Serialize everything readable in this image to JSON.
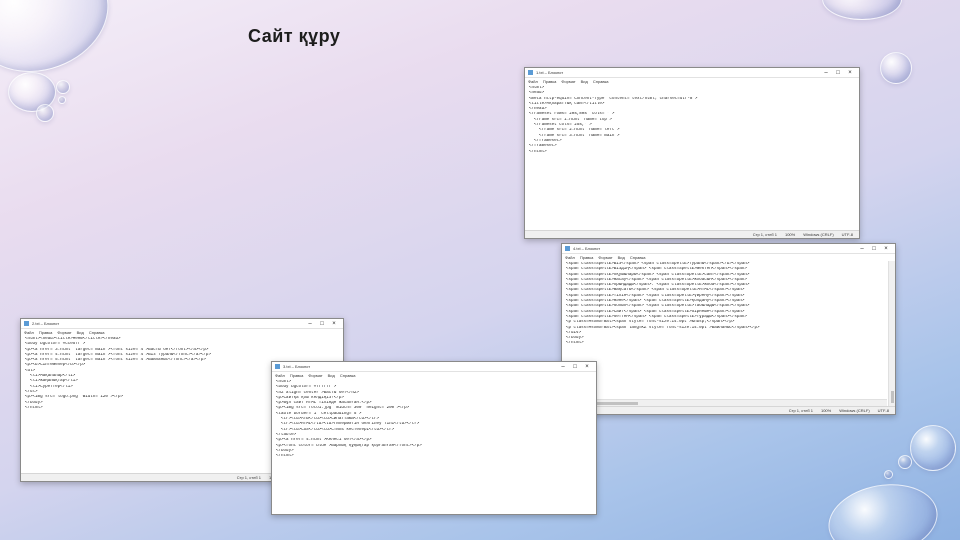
{
  "slide": {
    "title": "Сайт құру"
  },
  "windows": {
    "w1": {
      "title": "1.txt – Блокнот",
      "menu": [
        "Файл",
        "Правка",
        "Формат",
        "Вид",
        "Справка"
      ],
      "status": [
        "Стр 1, стлб 1",
        "100%",
        "Windows (CRLF)",
        "UTF-8"
      ],
      "lines": [
        "<html>",
        "<head>",
        "<meta http-equiv=\"Content-Type\" content=\"text/html; charset=utf-8\">",
        "<title>Ақпараттық сайт</title>",
        "</head>",
        "",
        "<frameset rows=\"20%,80%\" cols=\"*\">",
        "  <frame src=\"1.html\" name=\"top\">",
        "",
        "  <frameset cols=\"25%,*\">",
        "    <frame src=\"2.html\" name=\"left\">",
        "    <frame src=\"3.html\" name=\"main\">",
        "  </frameset>",
        "</frameset>",
        "",
        "</html>"
      ]
    },
    "w2": {
      "title": "2.txt – Блокнот",
      "menu": [
        "Файл",
        "Правка",
        "Формат",
        "Вид",
        "Справка"
      ],
      "status": [
        "Стр 1, стлб 1",
        "100%",
        "Windows (CRLF)",
        "UTF-8"
      ],
      "lines": [
        "<html><head><title>Меню</title></head>",
        "<body bgcolor=\"#cce5ff\">",
        "<p><a href=\"3.html\" target=\"main\"><font size=\"4\">Басты бет</font></a></p>",
        "<p><a href=\"4.html\" target=\"main\"><font size=\"4\">Біз туралы</font></a></p>",
        "<p><a href=\"5.html\" target=\"main\"><font size=\"4\">Байланыс</font></a></p>",
        "",
        "<p><b>Сілтемелер</b></p>",
        "<ul>",
        "  <li>Мақалалар</li>",
        "  <li>Жаңалықтар</li>",
        "  <li>Суреттер</li>",
        "</ul>",
        "<p><img src=\"logo.png\" width=\"120\"></p>",
        "",
        "</body>",
        "</html>"
      ]
    },
    "w3": {
      "title": "3.txt – Блокнот",
      "menu": [
        "Файл",
        "Правка",
        "Формат",
        "Вид",
        "Справка"
      ],
      "status": [
        "Стр 1, стлб 1",
        "100%",
        "Windows (CRLF)",
        "UTF-8"
      ],
      "lines": [
        "<html>",
        "<body bgcolor=\"#ffffff\">",
        "<h2 align=\"center\">Басты бет</h2>",
        "<p>Сайтқа қош келдіңіз!</p>",
        "<p>Бұл сайт HTML тілінде жасалған.</p>",
        "",
        "<p><img src=\"foto1.jpg\" width=\"300\" height=\"200\"></p>",
        "",
        "<table border=\"1\" cellpadding=\"5\">",
        "  <tr><td>Аты</td><td>Сипаттама</td></tr>",
        "  <tr><td>HTML</td><td>Гипермәтін белгілеу тілі</td></tr>",
        "  <tr><td>CSS</td><td>Стиль кестелері</td></tr>",
        "</table>",
        "",
        "<p><a href=\"4.html\">Келесі бет</a></p>",
        "",
        "<p><font color=\"blue\">Барлық құқықтар қорғалған</font></p>",
        "</body>",
        "</html>"
      ]
    },
    "w4": {
      "title": "4.txt – Блокнот",
      "menu": [
        "Файл",
        "Правка",
        "Формат",
        "Вид",
        "Справка"
      ],
      "status": [
        "Стр 1, стлб 1",
        "100%",
        "Windows (CRLF)",
        "UTF-8"
      ],
      "lines": [
        "<span class=SpellE>Біз</span> <span class=SpellE>туралы</span></b></span>",
        "<span class=SpellE>Біздің</span> <span class=SpellE>мектеп</span></span>",
        "<span class=SpellE>оқушылары</span> <span class=SpellE>сайт</span></span>",
        "<span class=SpellE>жасау</span> <span class=SpellE>жобасын</span></span>",
        "<span class=SpellE>орындады</span>. <span class=SpellE>Жоба</span></span>",
        "<span class=SpellE>мақсаты</span> <span class=SpellE>HTML</span></span>",
        "<span class=SpellE>тілін</span> <span class=SpellE>үйрену</span></span>",
        "<span class=SpellE>және</span> <span class=SpellE>қолдану</span></span>",
        "<span class=SpellE>болып</span> <span class=SpellE>табылады</span></span>",
        "<span class=SpellE>Сайт</span> <span class=SpellE>бірнеше</span></span>",
        "<span class=SpellE>беттен</span> <span class=SpellE>тұрады</span></span>",
        "<p class=MsoNormal><span style='font-size:14.0pt'>&nbsp;</span></p>",
        "",
        "<p class=MsoNormal><span lang=KZ style='font-size:14.0pt'>Байланыс</span></p>",
        "",
        "</div>",
        "",
        "</body>",
        "",
        "</html>"
      ]
    },
    "w5": {
      "title": "5.txt – Блокнот",
      "menu": [
        "Файл",
        "Правка",
        "Формат",
        "Вид",
        "Справка"
      ],
      "status": [
        "Стр 1, стлб 1",
        "100%",
        "Windows (CRLF)",
        "UTF-8"
      ],
      "lines": [
        "<html>",
        "<head><title>Байланыс</title></head>",
        "<body bgcolor=\"#ffffff\">",
        "<h3>Байланыс</h3>",
        "",
        "<p>Мекенжай: Алматы қаласы</p>",
        "<p>Телефон: 8 (727) 000-00-00</p>",
        "<p>Email: info@site.kz</p>",
        "",
        "<form>",
        "  Аты: <input type=\"text\"><br>",
        "  Хабарлама: <textarea></textarea><br>",
        "  <input type=\"submit\" value=\"Жіберу\">",
        "</form>",
        "",
        "<p><a href=\"3.html\">Басты бетке</a></p>",
        "</body>",
        "</html>"
      ]
    }
  }
}
